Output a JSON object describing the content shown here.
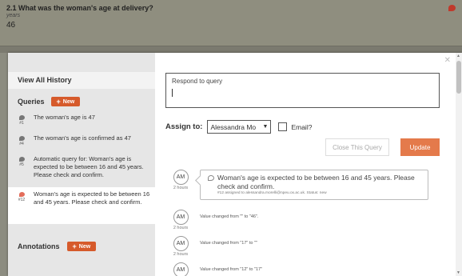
{
  "question": {
    "title": "2.1 What was the woman's age at delivery?",
    "unit": "years",
    "value": "46"
  },
  "sidebar": {
    "view_all": "View All History",
    "queries_label": "Queries",
    "new_label": "New",
    "queries": [
      {
        "text": "The woman's age is 47",
        "num": "#1"
      },
      {
        "text": "The woman's age is confirmed as 47",
        "num": "#4"
      },
      {
        "text": "Automatic query for: Woman's age is expected to be between 16 and 45 years. Please check and confirm.",
        "num": "#5"
      },
      {
        "text": "Woman's age is expected to be between 16 and 45 years. Please check and confirm.",
        "num": "#12"
      }
    ],
    "annotations_label": "Annotations",
    "annotations_new_label": "New"
  },
  "respond": {
    "placeholder": "Respond to query"
  },
  "assign": {
    "label": "Assign to:",
    "selected": "Alessandra Mo",
    "email_label": "Email?"
  },
  "buttons": {
    "close_query": "Close This Query",
    "update": "Update"
  },
  "history": [
    {
      "initials": "AM",
      "time": "2 hours",
      "type": "query",
      "text": "Woman's age is expected to be between 16 and 45 years. Please check and confirm.",
      "sub": "#12 assigned to alessandra.morelli@npeu.ox.ac.uk. Status: new"
    },
    {
      "initials": "AM",
      "time": "2 hours",
      "type": "change",
      "text": "Value changed from \"\" to \"46\"."
    },
    {
      "initials": "AM",
      "time": "2 hours",
      "type": "change",
      "text": "Value changed from \"17\" to \"\""
    },
    {
      "initials": "AM",
      "time": "",
      "type": "change",
      "text": "Value changed from \"12\" to \"17\""
    }
  ],
  "colors": {
    "accent": "#d65a2b",
    "update": "#e47a4b",
    "header_bg": "#8f8e7f"
  }
}
